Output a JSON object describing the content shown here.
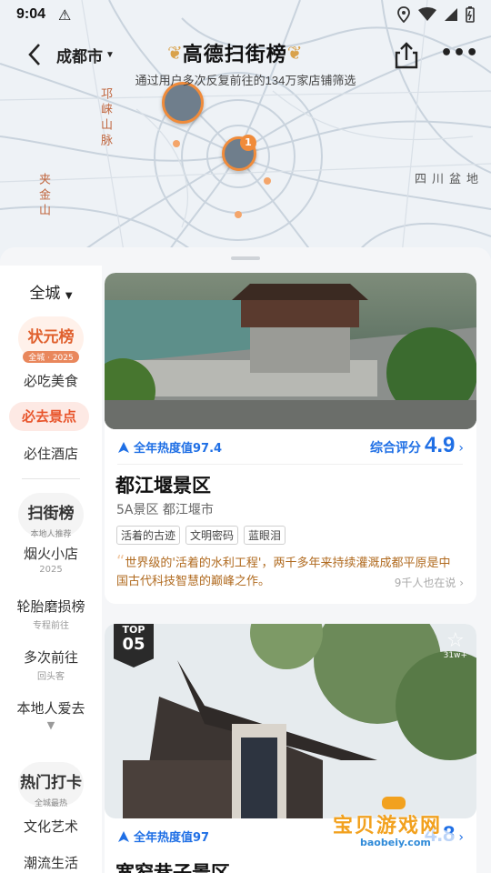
{
  "status_bar": {
    "time": "9:04",
    "warn_icon": "warning-icon"
  },
  "header": {
    "city": "成都市",
    "brand_title": "高德扫街榜",
    "subtitle": "通过用户多次反复前往的134万家店铺筛选"
  },
  "map": {
    "labels": {
      "range1": "邛崃山脉",
      "range2": "夹金山",
      "basin": "四川盆地"
    },
    "pin_badge": "1"
  },
  "rail": {
    "scope": "全城",
    "group1": {
      "name": "状元榜",
      "badge": "全城 · 2025"
    },
    "items1": [
      "必吃美食",
      "必去景点",
      "必住酒店"
    ],
    "group2": {
      "name": "扫街榜",
      "badge": "本地人推荐"
    },
    "items2": [
      {
        "label": "烟火小店",
        "sub": "2025"
      },
      {
        "label": "轮胎磨损榜",
        "sub": "专程前往"
      },
      {
        "label": "多次前往",
        "sub": "回头客"
      },
      {
        "label": "本地人爱去",
        "sub": ""
      }
    ],
    "group3": {
      "name": "热门打卡",
      "badge": "全城最热"
    },
    "items3": [
      "文化艺术",
      "潮流生活"
    ]
  },
  "cards": [
    {
      "heat": "全年热度值97.4",
      "score_label": "综合评分",
      "score": "4.9",
      "title": "都江堰景区",
      "meta": "5A景区  都江堰市",
      "tags": [
        "活着的古迹",
        "文明密码",
        "蓝眼泪"
      ],
      "quote": "世界级的'活着的水利工程'，两千多年来持续灌溉成都平原是中国古代科技智慧的巅峰之作。",
      "saying": "9千人也在说"
    },
    {
      "top_label": "TOP",
      "rank": "05",
      "fav_count": "31w+",
      "heat": "全年热度值97",
      "score": "4.8",
      "title": "宽窄巷子景区"
    }
  ],
  "watermark": {
    "line1": "宝贝游戏网",
    "line2": "baobeiy.com"
  }
}
